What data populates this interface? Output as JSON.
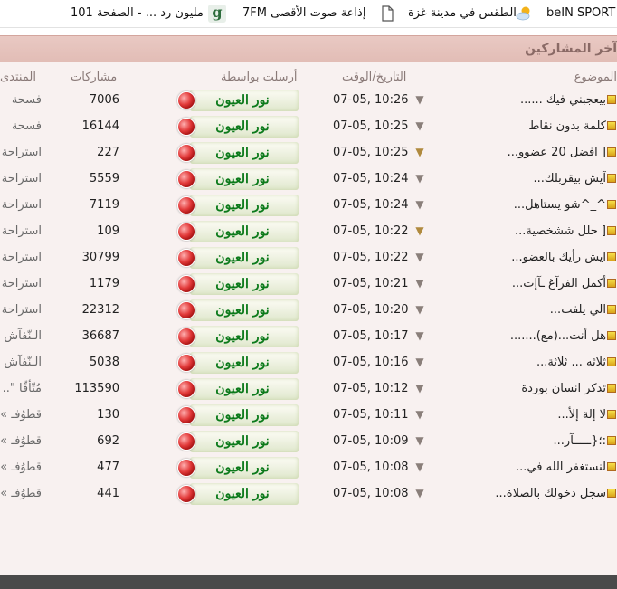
{
  "bookmarks": [
    {
      "label": "beIN SPORT",
      "icon": "weather-cloud-icon"
    },
    {
      "label": "الطقس في مدينة غزة",
      "icon": "page-icon"
    },
    {
      "label": "إذاعة صوت الأقصى 7FM",
      "icon": "g-icon"
    },
    {
      "label": "مليون رد ... - الصفحة 101",
      "icon": ""
    }
  ],
  "header": {
    "title": "آخر المشاركين"
  },
  "columns": {
    "topic": "الموضوع",
    "date": "التاريخ/الوقت",
    "poster": "أرسلت بواسطة",
    "replies": "مشاركات",
    "forum": "المنتدى"
  },
  "rows": [
    {
      "topic": "بيعجبني فيك ......",
      "date": "07-05, 10:26",
      "poster": "نور العيون",
      "replies": "7006",
      "forum": "فسحة",
      "arrow": "grey"
    },
    {
      "topic": "كلمة بدون نقاط",
      "date": "07-05, 10:25",
      "poster": "نور العيون",
      "replies": "16144",
      "forum": "فسحة",
      "arrow": "grey"
    },
    {
      "topic": "[ افضل 20 عضوو...",
      "date": "07-05, 10:25",
      "poster": "نور العيون",
      "replies": "227",
      "forum": "استراحة",
      "arrow": "gold"
    },
    {
      "topic": "آيش بيقربلك...",
      "date": "07-05, 10:24",
      "poster": "نور العيون",
      "replies": "5559",
      "forum": "استراحة",
      "arrow": "grey"
    },
    {
      "topic": "^_^شو يستاهل...",
      "date": "07-05, 10:24",
      "poster": "نور العيون",
      "replies": "7119",
      "forum": "استراحة",
      "arrow": "grey"
    },
    {
      "topic": "[ حلل ششخصية...",
      "date": "07-05, 10:22",
      "poster": "نور العيون",
      "replies": "109",
      "forum": "استراحة",
      "arrow": "gold"
    },
    {
      "topic": "ايش رأيك بالعضو...",
      "date": "07-05, 10:22",
      "poster": "نور العيون",
      "replies": "30799",
      "forum": "استراحة",
      "arrow": "grey"
    },
    {
      "topic": "أكمل الفرآغ ـآإت...",
      "date": "07-05, 10:21",
      "poster": "نور العيون",
      "replies": "1179",
      "forum": "استراحة",
      "arrow": "grey"
    },
    {
      "topic": "الي يلفت...",
      "date": "07-05, 10:20",
      "poster": "نور العيون",
      "replies": "22312",
      "forum": "استراحة",
      "arrow": "grey"
    },
    {
      "topic": "هل أنت...(مع).......",
      "date": "07-05, 10:17",
      "poster": "نور العيون",
      "replies": "36687",
      "forum": "الـنّفآش",
      "arrow": "grey"
    },
    {
      "topic": "ثلاثه ... ثلاثة...",
      "date": "07-05, 10:16",
      "poster": "نور العيون",
      "replies": "5038",
      "forum": "الـنّفآش",
      "arrow": "grey"
    },
    {
      "topic": "تذكر انسان بوردة",
      "date": "07-05, 10:12",
      "poster": "نور العيون",
      "replies": "113590",
      "forum": "مُتّأقّا \"..",
      "arrow": "grey"
    },
    {
      "topic": "لا إلة إلأ...",
      "date": "07-05, 10:11",
      "poster": "نور العيون",
      "replies": "130",
      "forum": "قطوُفـ »•",
      "arrow": "grey"
    },
    {
      "topic": ":؛{ـــــآر...",
      "date": "07-05, 10:09",
      "poster": "نور العيون",
      "replies": "692",
      "forum": "قطوُفـ »•",
      "arrow": "grey"
    },
    {
      "topic": "لنستغفر الله في...",
      "date": "07-05, 10:08",
      "poster": "نور العيون",
      "replies": "477",
      "forum": "قطوُفـ »•",
      "arrow": "grey"
    },
    {
      "topic": "سجل دخولك بالصلاة...",
      "date": "07-05, 10:08",
      "poster": "نور العيون",
      "replies": "441",
      "forum": "قطوُفـ »•",
      "arrow": "grey"
    }
  ]
}
